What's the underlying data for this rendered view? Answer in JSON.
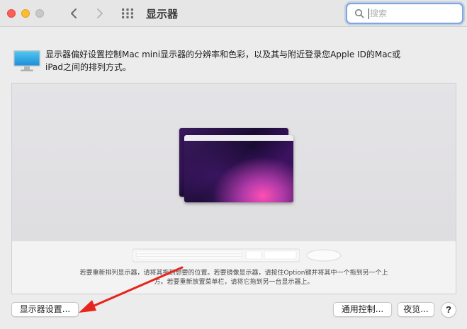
{
  "window": {
    "title": "显示器",
    "controls": [
      "close",
      "minimize",
      "zoom"
    ]
  },
  "toolbar": {
    "back_icon": "chevron-left-icon",
    "forward_icon": "chevron-right-icon",
    "show_all_icon": "grid-icon"
  },
  "search": {
    "placeholder": "搜索",
    "value": ""
  },
  "description": {
    "line1": "显示器偏好设置控制Mac mini显示器的分辨率和色彩，以及其与附近登录您Apple ID的Mac或",
    "line2": "iPad之间的排列方式。"
  },
  "arrangement": {
    "hint_line1": "若要重新排列显示器，请将其拖到想要的位置。若要镜像显示器，请按住Option键并将其中一个拖到另一个上",
    "hint_line2": "方。若要重新放置菜单栏，请将它拖到另一台显示器上。"
  },
  "buttons": {
    "display_settings": "显示器设置...",
    "universal_control": "通用控制...",
    "night_shift": "夜览...",
    "help": "?"
  },
  "colors": {
    "accent_focus": "#7fa6e0",
    "annotation_arrow": "#e8241c",
    "close": "#ff5f57",
    "minimize": "#febc2e"
  }
}
